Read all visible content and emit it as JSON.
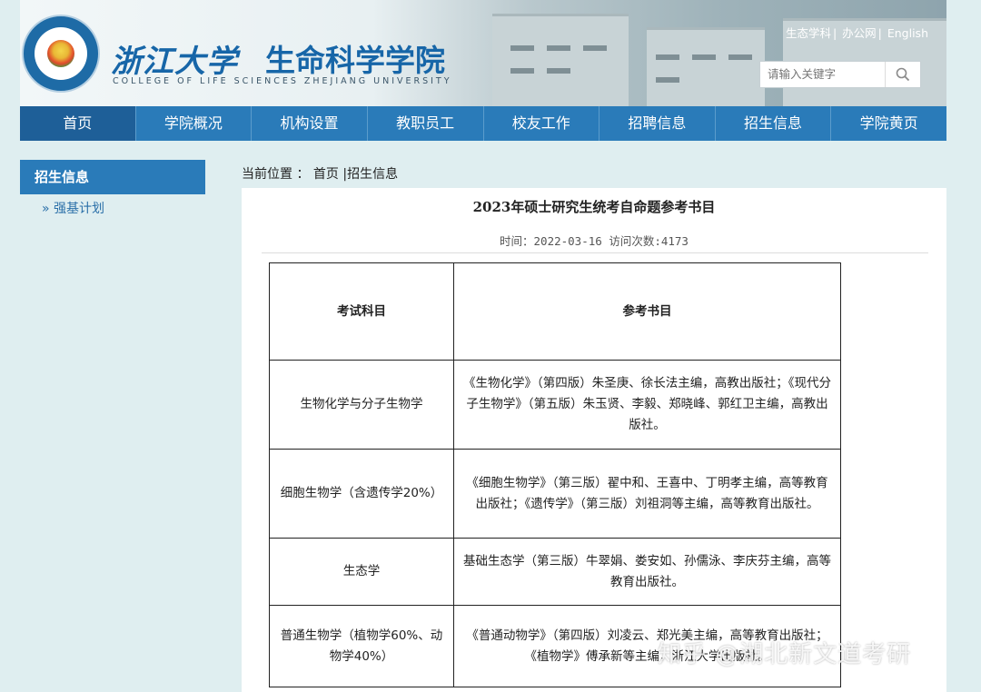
{
  "header": {
    "school_name_cn": "浙江大学",
    "college_name_cn": "生命科学学院",
    "school_name_en": "COLLEGE OF LIFE SCIENCES ZHEJIANG UNIVERSITY",
    "top_links": [
      "生态学科",
      "办公网",
      "English"
    ],
    "search_placeholder": "请输入关键字",
    "search_icon": "search-icon"
  },
  "nav": {
    "items": [
      "首页",
      "学院概况",
      "机构设置",
      "教职员工",
      "校友工作",
      "招聘信息",
      "招生信息",
      "学院黄页"
    ]
  },
  "sidebar": {
    "heading": "招生信息",
    "items": [
      {
        "bullet": "»",
        "label": "强基计划"
      }
    ]
  },
  "breadcrumb": {
    "prefix": "当前位置 ：",
    "items": [
      "首页",
      "招生信息"
    ],
    "separator": "|"
  },
  "article": {
    "title": "2023年硕士研究生统考自命题参考书目",
    "meta": "时间：2022-03-16 访问次数:4173",
    "table": {
      "headers": [
        "考试科目",
        "参考书目"
      ],
      "rows": [
        [
          "生物化学与分子生物学",
          "《生物化学》（第四版）朱圣庚、徐长法主编，高教出版社；《现代分子生物学》（第五版）朱玉贤、李毅、郑晓峰、郭红卫主编，高教出版社。"
        ],
        [
          "细胞生物学（含遗传学20%）",
          "《细胞生物学》（第三版）翟中和、王喜中、丁明孝主编，高等教育出版社；《遗传学》（第三版）刘祖洞等主编，高等教育出版社。"
        ],
        [
          "生态学",
          "基础生态学（第三版）牛翠娟、娄安如、孙儒泳、李庆芬主编，高等教育出版社。"
        ],
        [
          "普通生物学（植物学60%、动物学40%）",
          "《普通动物学》（第四版）刘凌云、郑光美主编，高等教育出版社；《植物学》傅承新等主编，浙江大学出版社。"
        ]
      ]
    }
  },
  "watermark": "知乎 @湖北新文道考研",
  "colors": {
    "nav": "#2a7bb9",
    "nav_active": "#1e5f98",
    "page_bg": "#dfeef0"
  }
}
